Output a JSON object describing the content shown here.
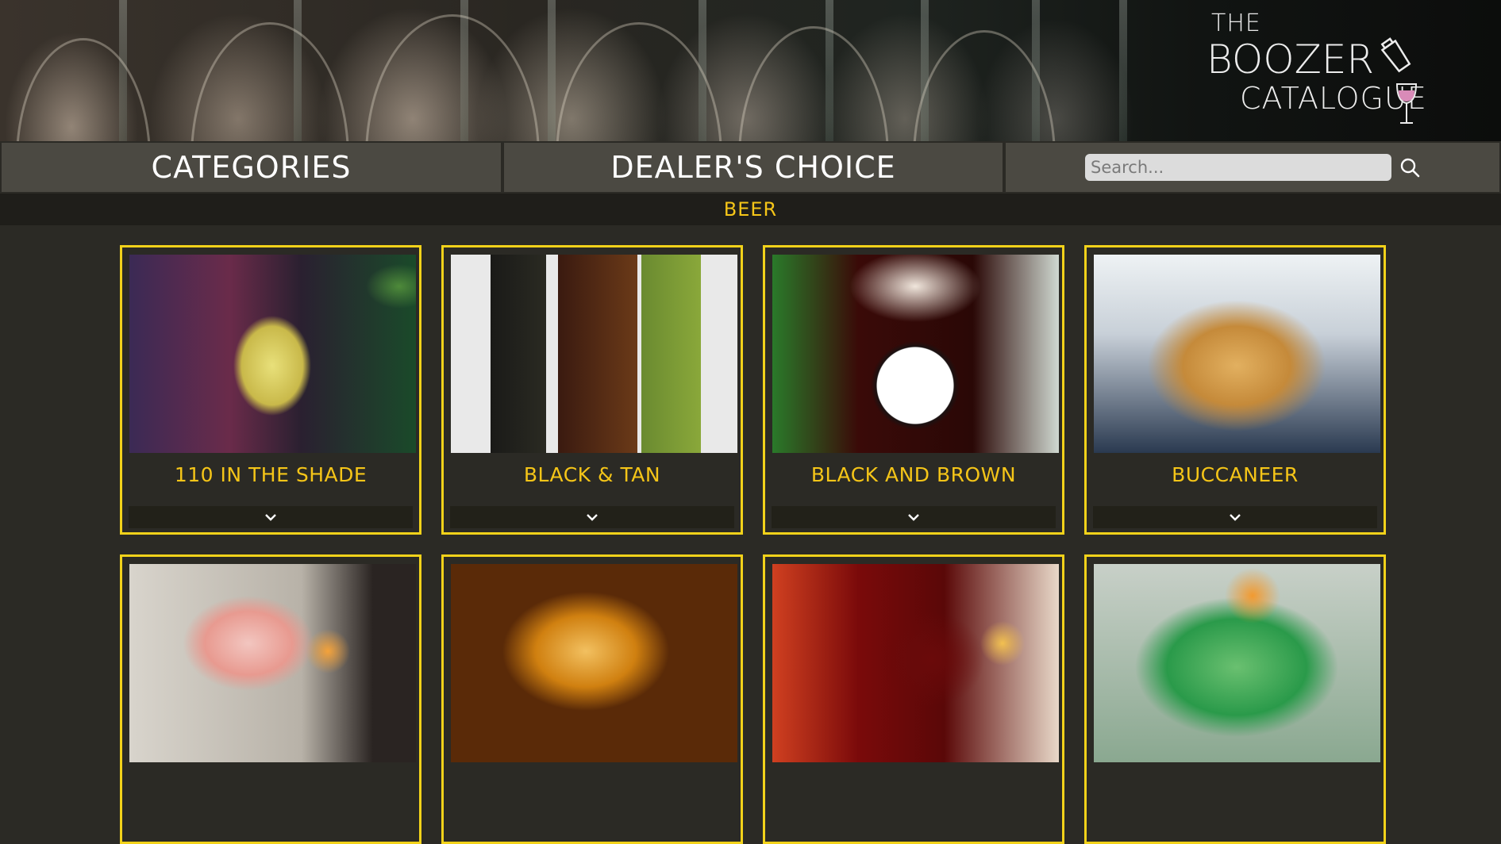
{
  "header": {
    "logo": {
      "line1": "THE",
      "line2": "BOOZER",
      "line3": "CATALOGUE"
    }
  },
  "nav": {
    "categories_label": "CATEGORIES",
    "dealers_choice_label": "DEALER'S CHOICE",
    "search": {
      "placeholder": "Search...",
      "value": ""
    }
  },
  "category": {
    "title": "BEER"
  },
  "drinks": [
    {
      "name": "110 IN THE SHADE"
    },
    {
      "name": "BLACK & TAN"
    },
    {
      "name": "BLACK AND BROWN"
    },
    {
      "name": "BUCCANEER"
    },
    {
      "name": ""
    },
    {
      "name": ""
    },
    {
      "name": ""
    },
    {
      "name": ""
    }
  ],
  "colors": {
    "accent": "#f2d21a",
    "background": "#2b2a25",
    "nav_background": "#4b4942",
    "category_bar": "#1f1e1a"
  },
  "icons": {
    "search": "search-icon",
    "expand": "chevron-down-icon",
    "shaker": "cocktail-shaker-icon",
    "wine": "wine-glass-icon"
  }
}
